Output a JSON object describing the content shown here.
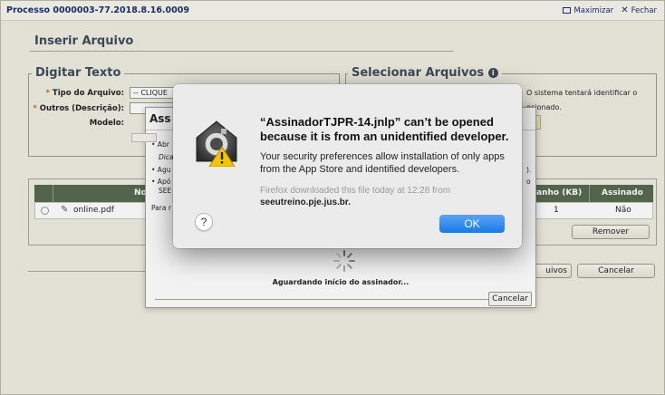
{
  "window": {
    "title": "Processo 0000003-77.2018.8.16.0009",
    "maximize_label": "Maximizar",
    "close_label": "Fechar"
  },
  "section": {
    "title": "Inserir Arquivo"
  },
  "digitar": {
    "legend": "Digitar Texto",
    "tipo_label": "Tipo do Arquivo:",
    "tipo_value": "-- CLIQUE",
    "outros_label": "Outros (Descrição):",
    "modelo_label": "Modelo:",
    "required_mark": "*"
  },
  "selecionar": {
    "legend": "Selecionar Arquivos",
    "info_icon": "i",
    "hint1": "O sistema tentará identificar o",
    "hint2": "ecionado."
  },
  "table": {
    "col_nome": "No",
    "col_tamanho": "anho (KB)",
    "col_assinado": "Assinado",
    "rows": [
      {
        "file": "online.pdf",
        "size": "1",
        "signed": "Não"
      }
    ]
  },
  "buttons": {
    "remover": "Remover",
    "arquivos": "uivos",
    "cancelar": "Cancelar"
  },
  "assinador": {
    "title": "Ass",
    "line1": "• Abr",
    "line2": "Dica",
    "line3": "• Agu",
    "line4": "• Apó",
    "line5": "SEE",
    "line6": "Para r",
    "right1": ").",
    "right2": "o",
    "wait_text": "Aguardando início do assinador...",
    "cancel_label": "Cancelar"
  },
  "alert": {
    "heading": "“AssinadorTJPR-14.jnlp” can’t be opened because it is from an unidentified developer.",
    "message": "Your security preferences allow installation of only apps from the App Store and identified developers.",
    "source_line": "Firefox downloaded this file today at 12:28 from",
    "source_host": "seeutreino.pje.jus.br.",
    "help_label": "?",
    "ok_label": "OK"
  },
  "colors": {
    "table_header": "#55694e",
    "ok_button": "#1a7ae8",
    "title_text": "#1d2c66",
    "required": "#d46a10"
  },
  "icons": [
    "gatekeeper-warning-icon",
    "info-icon",
    "pencil-icon",
    "spinner-icon",
    "maximize-icon",
    "close-icon"
  ]
}
